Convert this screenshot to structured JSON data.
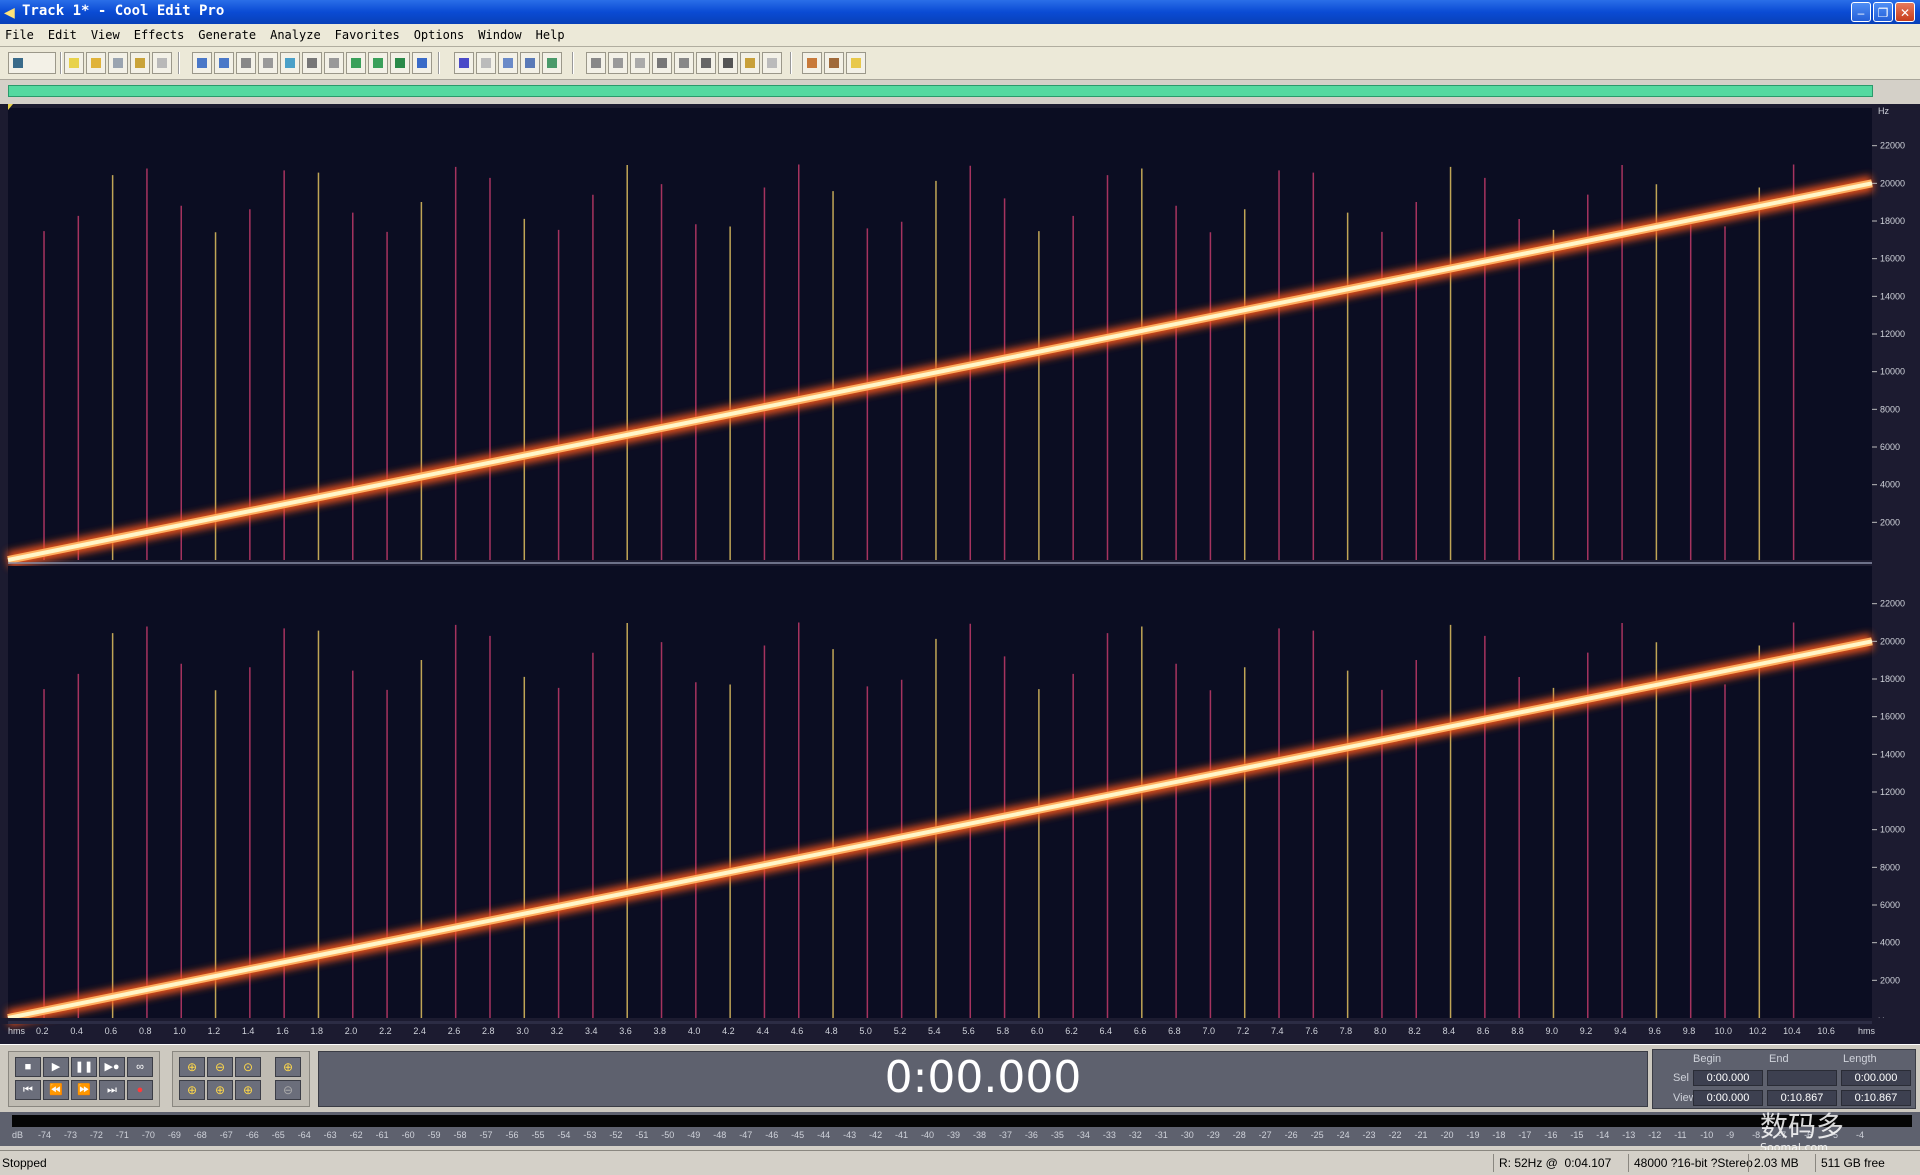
{
  "window": {
    "title": "Track 1* - Cool Edit Pro"
  },
  "menu": [
    "File",
    "Edit",
    "View",
    "Effects",
    "Generate",
    "Analyze",
    "Favorites",
    "Options",
    "Window",
    "Help"
  ],
  "spectrogram": {
    "freq_unit": "Hz",
    "freq_ticks": [
      "22000",
      "20000",
      "18000",
      "16000",
      "14000",
      "12000",
      "10000",
      "8000",
      "6000",
      "4000",
      "2000"
    ],
    "freq_max": 24000,
    "time_unit": "hms",
    "time_ticks": [
      "0.2",
      "0.4",
      "0.6",
      "0.8",
      "1.0",
      "1.2",
      "1.4",
      "1.6",
      "1.8",
      "2.0",
      "2.2",
      "2.4",
      "2.6",
      "2.8",
      "3.0",
      "3.2",
      "3.4",
      "3.6",
      "3.8",
      "4.0",
      "4.2",
      "4.4",
      "4.6",
      "4.8",
      "5.0",
      "5.2",
      "5.4",
      "5.6",
      "5.8",
      "6.0",
      "6.2",
      "6.4",
      "6.6",
      "6.8",
      "7.0",
      "7.2",
      "7.4",
      "7.6",
      "7.8",
      "8.0",
      "8.2",
      "8.4",
      "8.6",
      "8.8",
      "9.0",
      "9.2",
      "9.4",
      "9.6",
      "9.8",
      "10.0",
      "10.2",
      "10.4",
      "10.6"
    ],
    "duration": 10.867,
    "sweep_start_hz": 0,
    "sweep_end_hz": 20000,
    "colors": {
      "background": "#0b0d22",
      "sweep": "#fff6c8",
      "glow": "#ff5a1a",
      "harmonics": "#c23a6a"
    }
  },
  "transport": {
    "time": "0:00.000",
    "columns": {
      "begin": "Begin",
      "end": "End",
      "length": "Length"
    },
    "rows": [
      {
        "label": "Sel",
        "begin": "0:00.000",
        "end": "",
        "length": "0:00.000"
      },
      {
        "label": "View",
        "begin": "0:00.000",
        "end": "0:10.867",
        "length": "0:10.867"
      }
    ]
  },
  "meter": {
    "labels": [
      "dB",
      "-74",
      "-73",
      "-72",
      "-71",
      "-70",
      "-69",
      "-68",
      "-67",
      "-66",
      "-65",
      "-64",
      "-63",
      "-62",
      "-61",
      "-60",
      "-59",
      "-58",
      "-57",
      "-56",
      "-55",
      "-54",
      "-53",
      "-52",
      "-51",
      "-50",
      "-49",
      "-48",
      "-47",
      "-46",
      "-45",
      "-44",
      "-43",
      "-42",
      "-41",
      "-40",
      "-39",
      "-38",
      "-37",
      "-36",
      "-35",
      "-34",
      "-33",
      "-32",
      "-31",
      "-30",
      "-29",
      "-28",
      "-27",
      "-26",
      "-25",
      "-24",
      "-23",
      "-22",
      "-21",
      "-20",
      "-19",
      "-18",
      "-17",
      "-16",
      "-15",
      "-14",
      "-13",
      "-12",
      "-11",
      "-10",
      "-9",
      "-8",
      "-7",
      "-6",
      "-5",
      "-4"
    ]
  },
  "status": {
    "state": "Stopped",
    "cursor": "R: 52Hz @",
    "cursor_time": "0:04.107",
    "format": "48000 ?16-bit ?Stereo",
    "size": "2.03 MB",
    "free": "511 GB free"
  },
  "watermark": {
    "text": "数码多",
    "sub": "Soomal.com"
  }
}
